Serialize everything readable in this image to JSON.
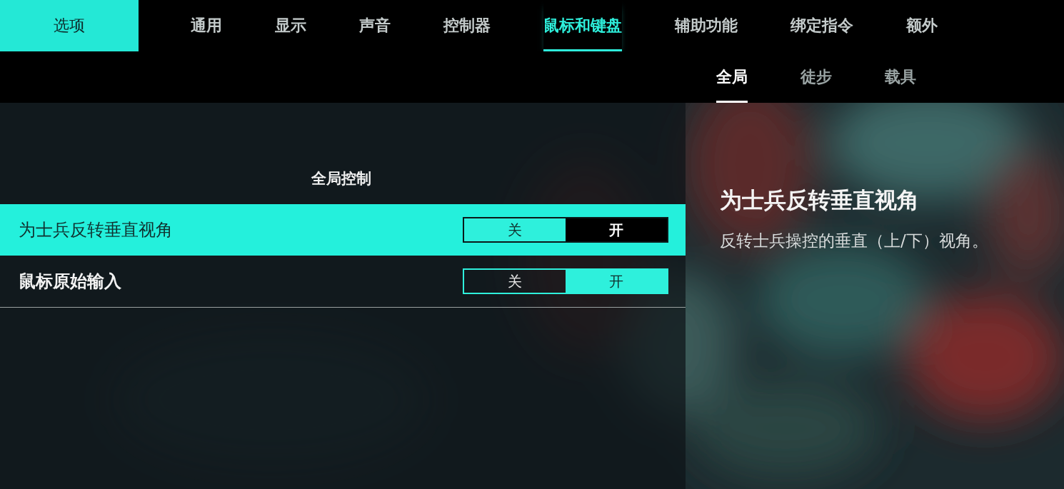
{
  "header": {
    "label": "选项"
  },
  "nav_tabs": [
    {
      "label": "通用",
      "selected": false
    },
    {
      "label": "显示",
      "selected": false
    },
    {
      "label": "声音",
      "selected": false
    },
    {
      "label": "控制器",
      "selected": false
    },
    {
      "label": "鼠标和键盘",
      "selected": true
    },
    {
      "label": "辅助功能",
      "selected": false
    },
    {
      "label": "绑定指令",
      "selected": false
    },
    {
      "label": "额外",
      "selected": false
    }
  ],
  "sub_tabs": [
    {
      "label": "全局",
      "selected": true
    },
    {
      "label": "徒步",
      "selected": false
    },
    {
      "label": "载具",
      "selected": false
    }
  ],
  "section_title": "全局控制",
  "settings": [
    {
      "label": "为士兵反转垂直视角",
      "focused": true,
      "options": [
        {
          "label": "关",
          "selected": false
        },
        {
          "label": "开",
          "selected": true
        }
      ]
    },
    {
      "label": "鼠标原始输入",
      "focused": false,
      "options": [
        {
          "label": "关",
          "selected": false
        },
        {
          "label": "开",
          "selected": true
        }
      ]
    }
  ],
  "detail": {
    "title": "为士兵反转垂直视角",
    "description": "反转士兵操控的垂直（上/下）视角。"
  }
}
